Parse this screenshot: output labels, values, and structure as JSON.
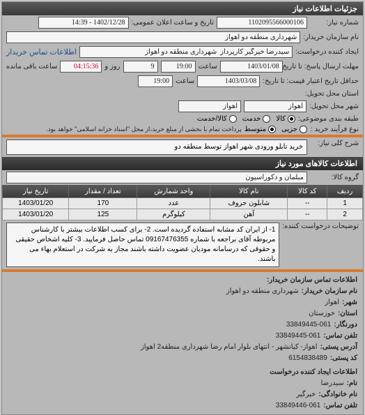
{
  "panel_title": "جزئیات اطلاعات نیاز",
  "form": {
    "req_number_label": "شماره نیاز:",
    "req_number": "1102095566000106",
    "announce_label": "تاریخ و ساعت اعلان عمومی:",
    "announce_value": "1402/12/28 - 14:39",
    "buyer_name_label": "نام سازمان خریدار:",
    "buyer_name": "شهرداری منطقه دو اهواز",
    "requester_label": "ایجاد کننده درخواست:",
    "requester": "سیدرضا خیرگیر کارپرداز  شهرداری منطقه دو اهواز",
    "buyer_contact_link": "اطلاعات تماس خریدار",
    "deadline_label": "مهلت ارسال پاسخ: تا تاریخ:",
    "deadline_date": "1403/01/08",
    "time_label": "ساعت",
    "deadline_time": "19:00",
    "days_remaining": "9",
    "days_text": "روز و",
    "time_remaining": "04:15:36",
    "remaining_text": "ساعت باقی مانده",
    "validity_label": "حداقل تاریخ اعتبار قیمت: تا تاریخ:",
    "validity_date": "1403/03/08",
    "validity_time": "19:00",
    "province_label": "استان محل تحویل:",
    "city_label": "شهر محل تحویل:",
    "province": "اهواز",
    "city": "اهواز",
    "topic_class_label": "طبقه بندی موضوعی:",
    "radio_goods": "کالا",
    "radio_service": "خدمت",
    "radio_goods_service": "کالا/خدمت",
    "purchase_type_label": "نوع فرآیند خرید :",
    "radio_small": "جزیی",
    "radio_medium": "متوسط",
    "purchase_note": "پرداخت تمام یا بخشی از مبلغ خرید،از محل \"اسناد خزانه اسلامی\" خواهد بود.",
    "general_desc_label": "شرح کلی نیاز:",
    "general_desc": "خرید تابلو ورودی شهر اهواز توسط منطقه دو"
  },
  "goods_section": {
    "title": "اطلاعات کالاهای مورد نیاز",
    "group_label": "گروه کالا:",
    "group_value": "مبلمان و دکوراسیون"
  },
  "table": {
    "headers": [
      "ردیف",
      "کد کالا",
      "نام کالا",
      "واحد شمارش",
      "تعداد / مقدار",
      "تاریخ نیاز"
    ],
    "rows": [
      [
        "1",
        "--",
        "شابلون حروف",
        "عدد",
        "170",
        "1403/01/20"
      ],
      [
        "2",
        "--",
        "آهن",
        "کیلوگرم",
        "125",
        "1403/01/20"
      ]
    ]
  },
  "requester_notes": {
    "label": "توضیحات درخواست کننده:",
    "text": "1- از ایران کد مشابه استفاده گردیده است. 2- برای کسب اطلاعات بیشتر با کارشناس مربوطه آقای براجعه با شماره 09167476355 تماس حاصل فرمایید. 3- کلیه اشخاص حقیقی و حقوقی که درسامانه مودیان عضویت داشته باشند مجاز به شرکت در استعلام بهاء می باشند."
  },
  "org_info": {
    "title": "اطلاعات تماس سازمان خریدار:",
    "org_name_label": "نام سازمان خریدار:",
    "org_name": "شهرداری منطقه دو اهواز",
    "city_label": "شهر:",
    "city": "اهواز",
    "province_label": "استان:",
    "province": "خوزستان",
    "fax_label": "دورنگار:",
    "fax": "33849445-061",
    "phone_label": "تلفن تماس:",
    "phone": "33849445-061",
    "address_label": "آدرس پستی:",
    "address": "اهواز- کیانشهر - انتهای بلوار امام رضا شهرداری منطقه2 اهواز",
    "postal_label": "کد پستی:",
    "postal": "6154838489"
  },
  "creator_info": {
    "title": "اطلاعات ایجاد کننده درخواست",
    "name_label": "نام:",
    "name": "سیدرضا",
    "family_label": "نام خانوادگی:",
    "family": "خیرگیر",
    "phone_label": "تلفن تماس:",
    "phone": "33849446-061"
  }
}
